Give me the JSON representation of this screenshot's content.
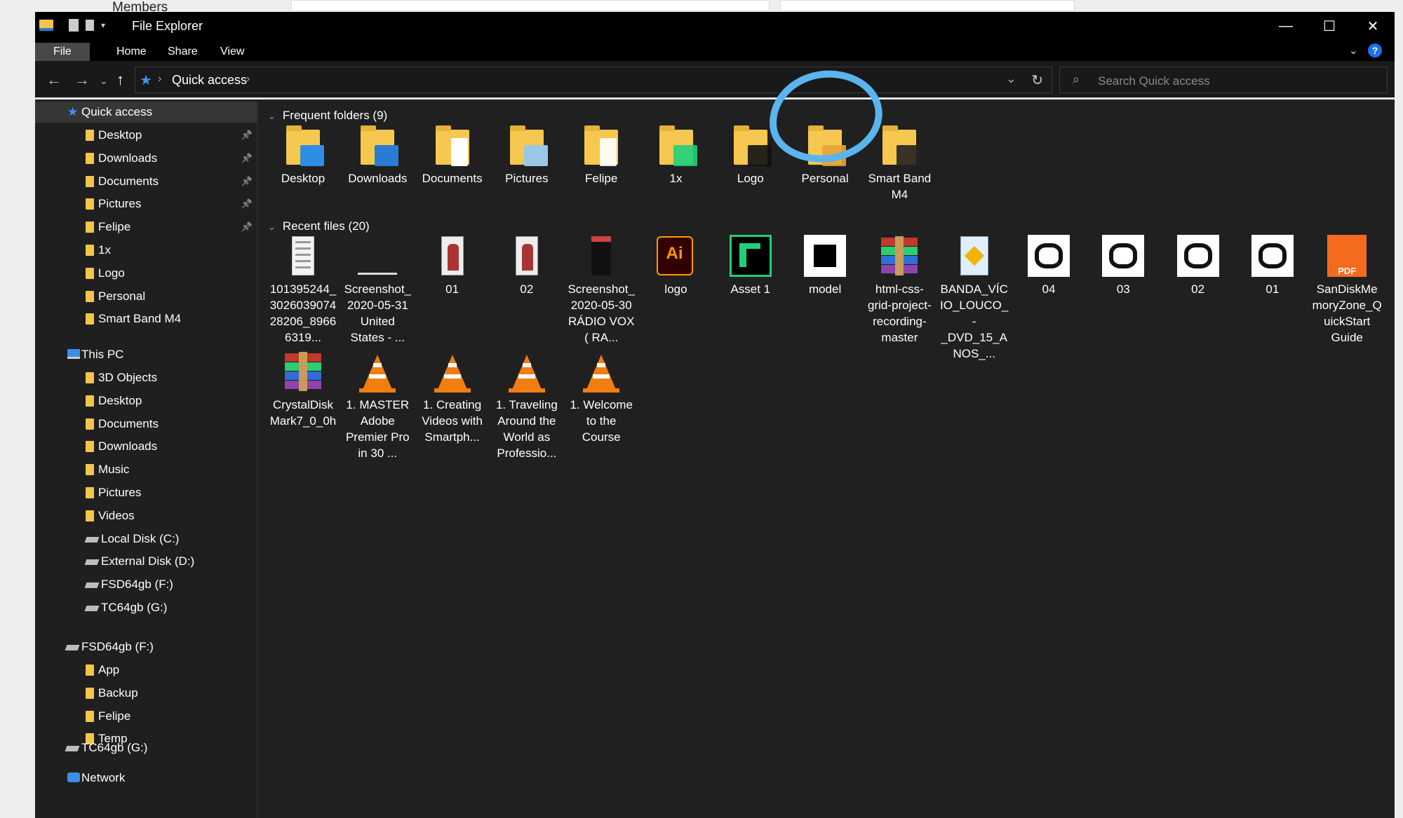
{
  "background": {
    "members_label": "Members"
  },
  "window": {
    "title": "File Explorer",
    "controls": {
      "minimize": "—",
      "maximize": "☐",
      "close": "✕"
    }
  },
  "ribbon": {
    "tabs": [
      "File",
      "Home",
      "Share",
      "View"
    ]
  },
  "address": {
    "location": "Quick access",
    "search_placeholder": "Search Quick access"
  },
  "sidebar": {
    "quick_access": "Quick access",
    "quick_items": [
      "Desktop",
      "Downloads",
      "Documents",
      "Pictures",
      "Felipe",
      "1x",
      "Logo",
      "Personal",
      "Smart Band M4"
    ],
    "this_pc": "This PC",
    "pc_items": [
      "3D Objects",
      "Desktop",
      "Documents",
      "Downloads",
      "Music",
      "Pictures",
      "Videos",
      "Local Disk (C:)",
      "External Disk (D:)",
      "FSD64gb (F:)",
      "TC64gb (G:)"
    ],
    "fsd_drive": "FSD64gb (F:)",
    "fsd_items": [
      "App",
      "Backup",
      "Felipe",
      "Temp"
    ],
    "tc_drive": "TC64gb (G:)",
    "network": "Network"
  },
  "main": {
    "frequent_header": "Frequent folders (9)",
    "frequent": [
      "Desktop",
      "Downloads",
      "Documents",
      "Pictures",
      "Felipe",
      "1x",
      "Logo",
      "Personal",
      "Smart Band M4"
    ],
    "recent_header": "Recent files (20)",
    "recent": [
      "101395244_302603907428206_89666319...",
      "Screenshot_2020-05-31 United States - ...",
      "01",
      "02",
      "Screenshot_2020-05-30 RÁDIO VOX ( RA...",
      "logo",
      "Asset 1",
      "model",
      "html-css-grid-project-recording-master",
      "BANDA_VÍCIO_LOUCO_-_DVD_15_ANOS_...",
      "04",
      "03",
      "02",
      "01",
      "SanDiskMemoryZone_QuickStart Guide",
      "CrystalDiskMark7_0_0h",
      "1. MASTER Adobe Premier Pro in 30 ...",
      "1. Creating Videos with Smartph...",
      "1. Traveling Around the World as Professio...",
      "1. Welcome to the Course"
    ]
  },
  "colors": {
    "accent": "#1a73e8",
    "folder": "#f6c84f",
    "annotation": "#5ab4ee"
  }
}
